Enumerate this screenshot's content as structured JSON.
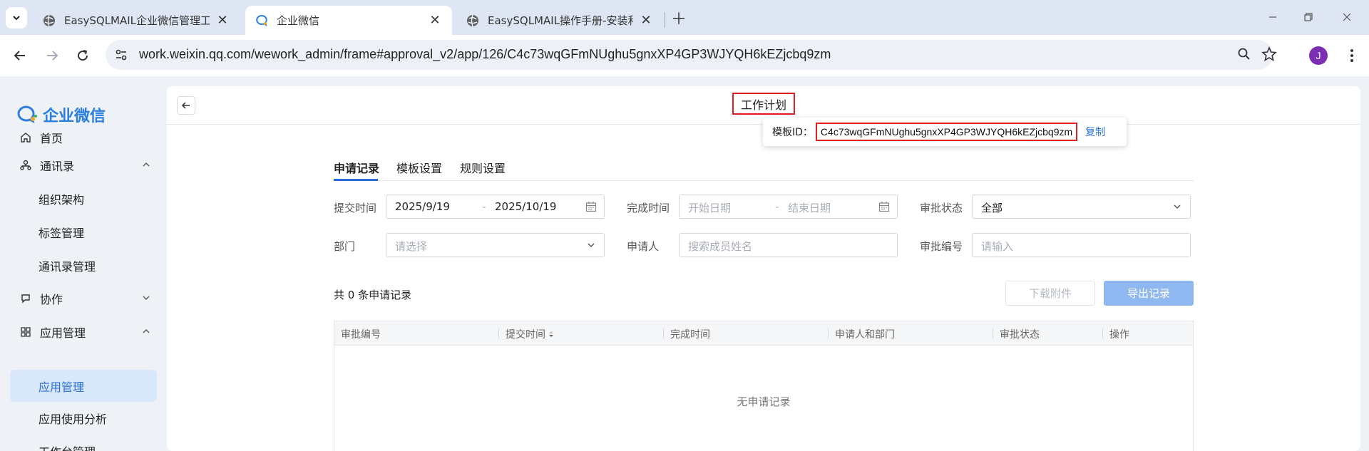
{
  "browser": {
    "tabs": [
      {
        "title": "EasySQLMAIL企业微信管理工具",
        "active": false
      },
      {
        "title": "企业微信",
        "active": true
      },
      {
        "title": "EasySQLMAIL操作手册-安装和",
        "active": false
      }
    ],
    "url": "work.weixin.qq.com/wework_admin/frame#approval_v2/app/126/C4c73wqGFmNUghu5gnxXP4GP3WJYQH6kEZjcbq9zm",
    "profile_initial": "J",
    "colors": {
      "avatar": "#7b2fb5",
      "accent": "#2a6fd6",
      "highlight": "#e02020"
    }
  },
  "sidebar": {
    "logo_text": "企业微信",
    "items": [
      {
        "label": "首页",
        "icon": "home-icon"
      },
      {
        "label": "通讯录",
        "icon": "org-icon"
      },
      {
        "label": "组织架构"
      },
      {
        "label": "标签管理"
      },
      {
        "label": "通讯录管理"
      },
      {
        "label": "协作",
        "icon": "collab-icon"
      },
      {
        "label": "应用管理",
        "icon": "apps-icon"
      },
      {
        "label": "应用管理",
        "selected": true
      },
      {
        "label": "应用使用分析"
      },
      {
        "label": "工作台管理"
      }
    ]
  },
  "main": {
    "app_title": "工作计划",
    "template": {
      "label": "模板ID：",
      "id": "C4c73wqGFmNUghu5gnxXP4GP3WJYQH6kEZjcbq9zm",
      "copy": "复制"
    },
    "tabs": [
      "申请记录",
      "模板设置",
      "规则设置"
    ],
    "filters": {
      "submit_time": {
        "label": "提交时间",
        "start": "2025/9/19",
        "end": "2025/10/19"
      },
      "complete_time": {
        "label": "完成时间",
        "start_ph": "开始日期",
        "end_ph": "结束日期"
      },
      "status": {
        "label": "审批状态",
        "value": "全部"
      },
      "department": {
        "label": "部门",
        "placeholder": "请选择"
      },
      "applicant": {
        "label": "申请人",
        "placeholder": "搜索成员姓名"
      },
      "approval_no": {
        "label": "审批编号",
        "placeholder": "请输入"
      }
    },
    "count_text": "共 0 条申请记录",
    "download_btn": "下载附件",
    "export_btn": "导出记录",
    "columns": [
      "审批编号",
      "提交时间",
      "完成时间",
      "申请人和部门",
      "审批状态",
      "操作"
    ],
    "empty_text": "无申请记录"
  }
}
